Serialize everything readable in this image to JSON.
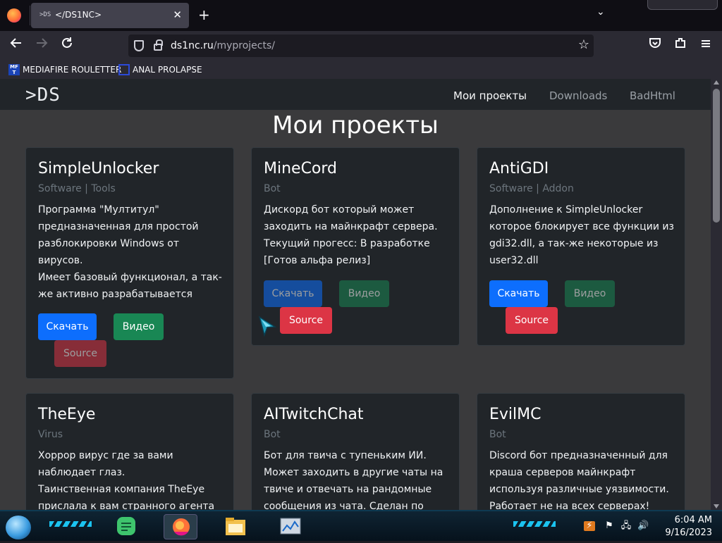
{
  "browser": {
    "tab": {
      "favicon_text": ">DS",
      "title": "</DS1NC>",
      "close": "✕"
    },
    "new_tab": "+",
    "tab_list": "⌄",
    "url_domain": "ds1nc.ru",
    "url_path": "/myprojects/",
    "bookmarks": [
      {
        "icon_text": "MF\nT",
        "label": "MEDIAFIRE ROULETTER"
      },
      {
        "label": "ANAL PROLAPSE"
      }
    ]
  },
  "site": {
    "logo": ">DS",
    "nav": [
      {
        "label": "Мои проекты",
        "active": true
      },
      {
        "label": "Downloads",
        "active": false
      },
      {
        "label": "BadHtml",
        "active": false
      }
    ],
    "title": "Мои проекты",
    "cards": [
      {
        "title": "SimpleUnlocker",
        "subtitle": "Software | Tools",
        "description": [
          "Программа \"Мултитул\" предназначенная для простой разблокировки Windows от вирусов.",
          "Имеет базовый функционал, а так-же активно разрабатывается"
        ],
        "buttons": {
          "download": "Скачать",
          "video": "Видео",
          "source": "Source"
        }
      },
      {
        "title": "MineCord",
        "subtitle": "Bot",
        "description": [
          "Дискорд бот который может заходить на майнкрафт сервера.",
          "Текущий прогесс: В разработке [Готов альфа релиз]"
        ],
        "buttons": {
          "download": "Скачать",
          "video": "Видео",
          "source": "Source"
        }
      },
      {
        "title": "AntiGDI",
        "subtitle": "Software | Addon",
        "description": [
          "Дополнение к SimpleUnlocker которое блокирует все функции из gdi32.dll, а так-же некоторые из user32.dll"
        ],
        "buttons": {
          "download": "Скачать",
          "video": "Видео",
          "source": "Source"
        }
      },
      {
        "title": "TheEye",
        "subtitle": "Virus",
        "description": [
          "Хоррор вирус где за вами наблюдает глаз.",
          "Таинственная компания TheEye прислала к вам странного агента"
        ]
      },
      {
        "title": "AITwitchChat",
        "subtitle": "Bot",
        "description": [
          "Бот для твича с тупеньким ИИ. Может заходить в другие чаты на твиче и отвечать на рандомные сообщения из чата. Сделан по"
        ]
      },
      {
        "title": "EvilMC",
        "subtitle": "Bot",
        "description": [
          "Discord бот предназначенный для краша серверов майнкрафт используя различные уязвимости. Работает не на всех серверах!"
        ]
      }
    ]
  },
  "taskbar": {
    "time": "6:04 AM",
    "date": "9/16/2023"
  },
  "colors": {
    "blue": "#0d6efd",
    "green": "#198754",
    "red": "#dc3545",
    "card_bg": "#212529",
    "page_bg": "#3a3a3c"
  }
}
